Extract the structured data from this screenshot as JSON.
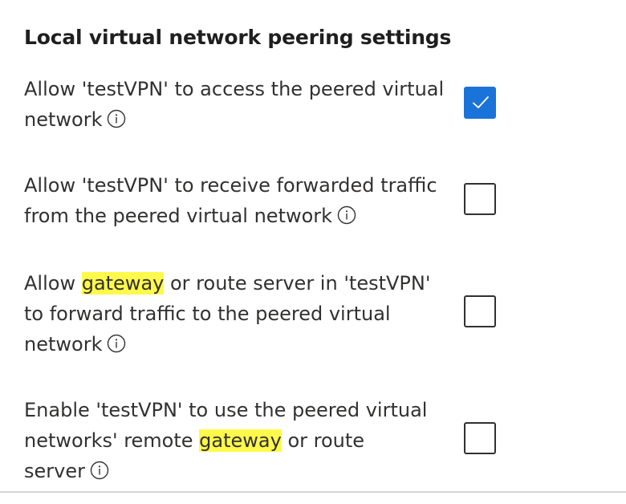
{
  "section_title": "Local virtual network peering settings",
  "settings": [
    {
      "id": "access",
      "line1": "Allow 'testVPN' to access the peered virtual",
      "line2": "network",
      "checked": true
    },
    {
      "id": "forwarded",
      "line1": "Allow 'testVPN' to receive forwarded traffic",
      "line2": "from the peered virtual network",
      "checked": false
    },
    {
      "id": "gateway-transit",
      "line1_pre": "Allow ",
      "line1_hl": "gateway",
      "line1_post": " or route server in 'testVPN'",
      "line2": "to forward traffic to the peered virtual",
      "line3": "network",
      "checked": false
    },
    {
      "id": "remote-gateway",
      "line1": "Enable 'testVPN' to use the peered virtual",
      "line2_pre": "networks' remote ",
      "line2_hl": "gateway",
      "line2_post": " or route",
      "line3": "server",
      "checked": false
    }
  ],
  "colors": {
    "checkbox_checked": "#1a73d9",
    "highlight": "#fff94c",
    "text": "#323130"
  },
  "icons": {
    "info": "info-circle-icon",
    "check": "checkmark-icon"
  }
}
